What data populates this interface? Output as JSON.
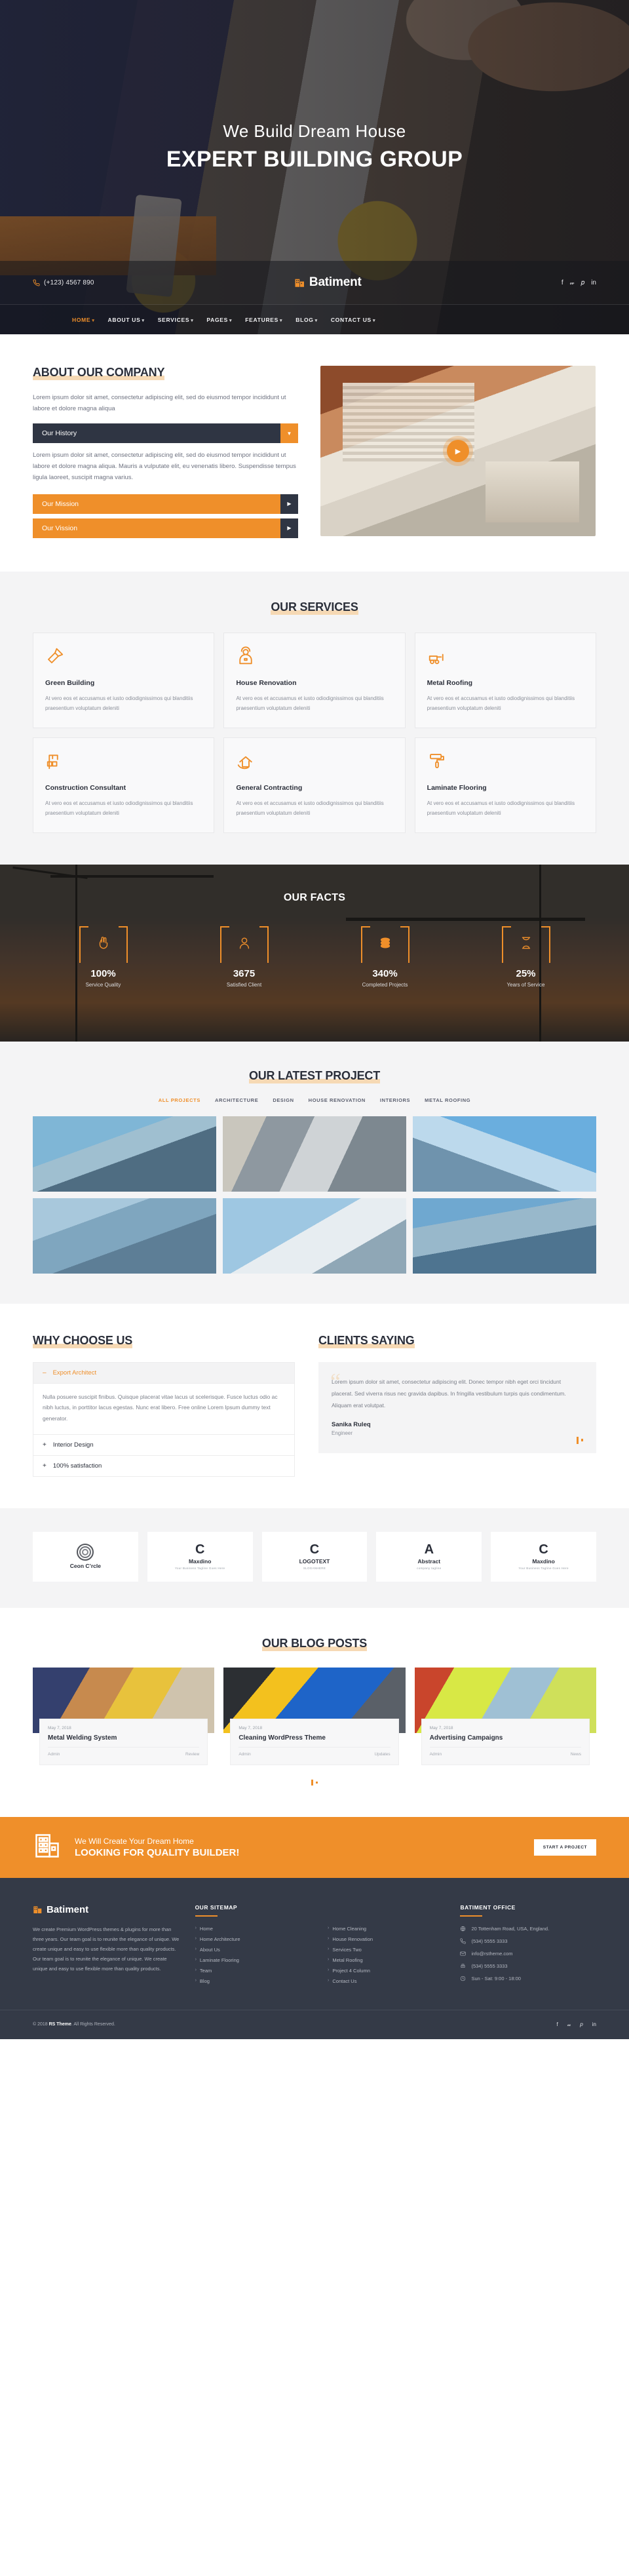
{
  "hero": {
    "subtitle": "We Build Dream House",
    "title": "EXPERT BUILDING GROUP"
  },
  "header": {
    "phone": "(+123) 4567 890",
    "brand": "Batiment",
    "socials": [
      "facebook-icon",
      "twitter-icon",
      "pinterest-icon",
      "linkedin-icon"
    ],
    "nav": [
      {
        "label": "HOME",
        "active": true
      },
      {
        "label": "ABOUT US",
        "active": false
      },
      {
        "label": "SERVICES",
        "active": false
      },
      {
        "label": "PAGES",
        "active": false
      },
      {
        "label": "FEATURES",
        "active": false
      },
      {
        "label": "BLOG",
        "active": false
      },
      {
        "label": "CONTACT US",
        "active": false
      }
    ]
  },
  "about": {
    "title": "ABOUT OUR COMPANY",
    "intro": "Lorem ipsum dolor sit amet, consectetur adipiscing elit, sed do eiusmod tempor incididunt ut labore et dolore magna aliqua",
    "accordion": [
      {
        "label": "Our History",
        "open": true
      },
      {
        "label": "Our Mission",
        "open": false
      },
      {
        "label": "Our Vission",
        "open": false
      }
    ],
    "body": "Lorem ipsum dolor sit amet, consectetur adipiscing elit, sed do eiusmod tempor incididunt ut labore et dolore magna aliqua. Mauris a vulputate elit, eu venenatis libero. Suspendisse tempus ligula laoreet, suscipit magna varius."
  },
  "services": {
    "title": "OUR SERVICES",
    "items": [
      {
        "icon": "paint-brush-icon",
        "title": "Green Building",
        "text": "At vero eos et accusamus et iusto odiodignissimos qui blanditiis praesentium voluptatum deleniti"
      },
      {
        "icon": "worker-icon",
        "title": "House Renovation",
        "text": "At vero eos et accusamus et iusto odiodignissimos qui blanditiis praesentium voluptatum deleniti"
      },
      {
        "icon": "bulldozer-icon",
        "title": "Metal Roofing",
        "text": "At vero eos et accusamus et iusto odiodignissimos qui blanditiis praesentium voluptatum deleniti"
      },
      {
        "icon": "crane-icon",
        "title": "Construction Consultant",
        "text": "At vero eos et accusamus et iusto odiodignissimos qui blanditiis praesentium voluptatum deleniti"
      },
      {
        "icon": "house-hand-icon",
        "title": "General Contracting",
        "text": "At vero eos et accusamus et iusto odiodignissimos qui blanditiis praesentium voluptatum deleniti"
      },
      {
        "icon": "paint-roller-icon",
        "title": "Laminate Flooring",
        "text": "At vero eos et accusamus et iusto odiodignissimos qui blanditiis praesentium voluptatum deleniti"
      }
    ]
  },
  "facts": {
    "title": "OUR FACTS",
    "items": [
      {
        "icon": "victory-hand-icon",
        "value": "100%",
        "label": "Service Quality"
      },
      {
        "icon": "person-icon",
        "value": "3675",
        "label": "Satisfied Client"
      },
      {
        "icon": "coins-icon",
        "value": "340%",
        "label": "Completed Projects"
      },
      {
        "icon": "hourglass-icon",
        "value": "25%",
        "label": "Years of Service"
      }
    ]
  },
  "projects": {
    "title": "OUR LATEST PROJECT",
    "filters": [
      {
        "label": "ALL PROJECTS",
        "active": true
      },
      {
        "label": "ARCHITECTURE",
        "active": false
      },
      {
        "label": "DESIGN",
        "active": false
      },
      {
        "label": "HOUSE RENOVATION",
        "active": false
      },
      {
        "label": "INTERIORS",
        "active": false
      },
      {
        "label": "METAL ROOFING",
        "active": false
      }
    ],
    "tiles": [
      "project-1",
      "project-2",
      "project-3",
      "project-4",
      "project-5",
      "project-6"
    ]
  },
  "why": {
    "title": "WHY CHOOSE US",
    "toggles": [
      {
        "label": "Export Architect",
        "open": true,
        "sym": "–"
      },
      {
        "label": "Interior Design",
        "open": false,
        "sym": "+"
      },
      {
        "label": "100% satisfaction",
        "open": false,
        "sym": "+"
      }
    ],
    "body": "Nulla posuere suscipit finibus. Quisque placerat vitae lacus ut scelerisque. Fusce luctus odio ac nibh luctus, in porttitor lacus egestas. Nunc erat libero. Free online Lorem Ipsum dummy text generator."
  },
  "testimonial": {
    "title": "CLIENTS SAYING",
    "quote": "Lorem ipsum dolor sit amet, consectetur adipiscing elit. Donec tempor nibh eget orci tincidunt placerat. Sed viverra risus nec gravida dapibus. In fringilla vestibulum turpis quis condimentum. Aliquam erat volutpat.",
    "name": "Sanika Ruleq",
    "role": "Engineer"
  },
  "clients": [
    {
      "mark": "rings",
      "name": "Ceon C’rcle",
      "tagline": ""
    },
    {
      "mark": "C",
      "name": "Maxdino",
      "tagline": "Your Business Tagline Goes Here"
    },
    {
      "mark": "C",
      "name": "LOGOTEXT",
      "tagline": "SLOGANHERE"
    },
    {
      "mark": "A",
      "name": "Abstract",
      "tagline": "company tagline"
    },
    {
      "mark": "C",
      "name": "Maxdino",
      "tagline": "Your Business Tagline Goes Here"
    }
  ],
  "blog": {
    "title": "OUR BLOG POSTS",
    "posts": [
      {
        "date": "May 7, 2018",
        "title": "Metal Welding System",
        "author": "Admin",
        "category": "Review"
      },
      {
        "date": "May 7, 2018",
        "title": "Cleaning WordPress Theme",
        "author": "Admin",
        "category": "Updates"
      },
      {
        "date": "May 7, 2018",
        "title": "Advertising Campaigns",
        "author": "Admin",
        "category": "News"
      }
    ]
  },
  "cta": {
    "icon": "building-icon",
    "small": "We Will Create Your Dream Home",
    "big": "LOOKING FOR QUALITY BUILDER!",
    "button": "START A PROJECT"
  },
  "footer": {
    "brand": "Batiment",
    "about": "We create Premium WordPress themes & plugins for more than three years. Our team goal is to reunite the elegance of unique. We create unique and easy to use flexible more than quality products. Our team goal is to reunite the elegance of unique. We create unique and easy to use flexible more than quality products.",
    "sitemap_head": "OUR SITEMAP",
    "sitemap": [
      "Home",
      "Home Architecture",
      "About Us",
      "Laminate Flooring",
      "Team",
      "Blog"
    ],
    "sitemap2": [
      "Home Cleaning",
      "House Renovation",
      "Services Two",
      "Metal Roofing",
      "Project 4 Column",
      "Contact Us"
    ],
    "office_head": "BATIMENT OFFICE",
    "office": [
      {
        "icon": "globe-icon",
        "text": "20 Tottenham Road, USA, England."
      },
      {
        "icon": "phone-icon",
        "text": "(534) 5555 3333"
      },
      {
        "icon": "mail-icon",
        "text": "info@rstheme.com"
      },
      {
        "icon": "fax-icon",
        "text": "(534) 5555 3333"
      },
      {
        "icon": "clock-icon",
        "text": "Sun - Sat: 9:00 - 18:00"
      }
    ],
    "copyright_prefix": "© 2018 ",
    "copyright_brand": "RS Theme",
    "copyright_suffix": ". All Rights Reserved.",
    "socials": [
      "facebook-icon",
      "twitter-icon",
      "pinterest-icon",
      "linkedin-icon"
    ]
  },
  "colors": {
    "accent": "#ef8f2a",
    "dark": "#343a47",
    "light": "#f4f4f5"
  }
}
